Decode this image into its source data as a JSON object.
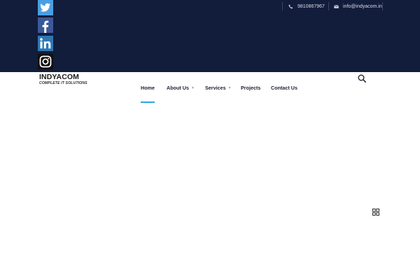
{
  "topbar": {
    "social": [
      {
        "icon": "twitter-icon",
        "color": "#4a9fe3"
      },
      {
        "icon": "facebook-icon",
        "color": "#3b5998"
      },
      {
        "icon": "linkedin-icon",
        "color": "#2d77b3"
      },
      {
        "icon": "instagram-icon",
        "color": "#111111"
      }
    ],
    "phone": {
      "icon": "phone-icon",
      "text": "9810867967"
    },
    "email": {
      "icon": "mail-icon",
      "text": "info@indyacom.in"
    },
    "background": "#121c3b"
  },
  "header": {
    "logo": {
      "name": "INDYACOM",
      "tagline": "COMPLETE IT SOLUTIONS"
    },
    "nav": [
      {
        "label": "Home",
        "active": true
      },
      {
        "label": "About Us",
        "has_dropdown": true
      },
      {
        "label": "Services",
        "has_dropdown": true
      },
      {
        "label": "Projects"
      },
      {
        "label": "Contact Us"
      }
    ],
    "accent": "#2aa7e0",
    "search_icon": "search-icon"
  },
  "floating": {
    "grid_icon": "grid-icon"
  }
}
